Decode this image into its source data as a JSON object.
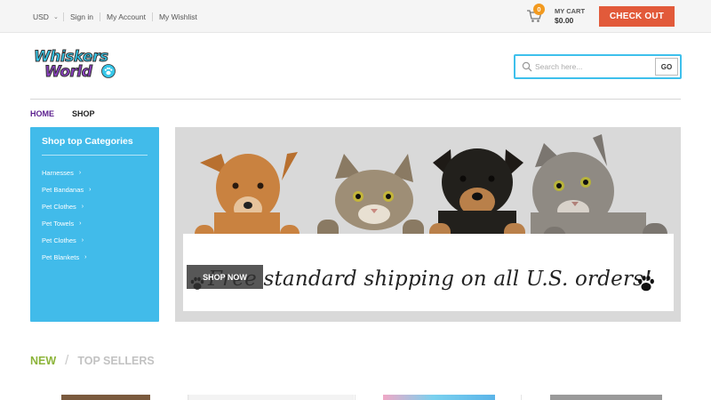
{
  "topbar": {
    "currency": "USD",
    "links": [
      "Sign in",
      "My Account",
      "My Wishlist"
    ],
    "cart": {
      "count": "0",
      "label": "MY CART",
      "total": "$0.00"
    },
    "checkout_label": "CHECK OUT"
  },
  "header": {
    "logo": {
      "line1": "Whiskers",
      "line2": "World"
    },
    "search": {
      "placeholder": "Search here...",
      "value": "",
      "button_label": "GO"
    }
  },
  "nav": {
    "items": [
      {
        "label": "HOME",
        "active": true
      },
      {
        "label": "SHOP",
        "active": false
      }
    ]
  },
  "sidebar": {
    "title": "Shop top Categories",
    "items": [
      "Harnesses",
      "Pet Bandanas",
      "Pet Clothes",
      "Pet Towels",
      "Pet Clothes",
      "Pet Blankets"
    ]
  },
  "banner": {
    "sign_text": "Free standard shipping on all U.S. orders!",
    "button_label": "SHOP NOW"
  },
  "product_tabs": {
    "new_label": "NEW",
    "separator": "/",
    "top_label": "TOP SELLERS"
  },
  "colors": {
    "accent_blue": "#41bbea",
    "checkout_red": "#e25a3a",
    "nav_active": "#5b1f8e",
    "new_green": "#8cb43a",
    "badge_orange": "#f29a1f"
  },
  "icons": [
    "chevron-down-icon",
    "cart-icon",
    "search-icon",
    "paw-icon",
    "chevron-right-icon"
  ]
}
